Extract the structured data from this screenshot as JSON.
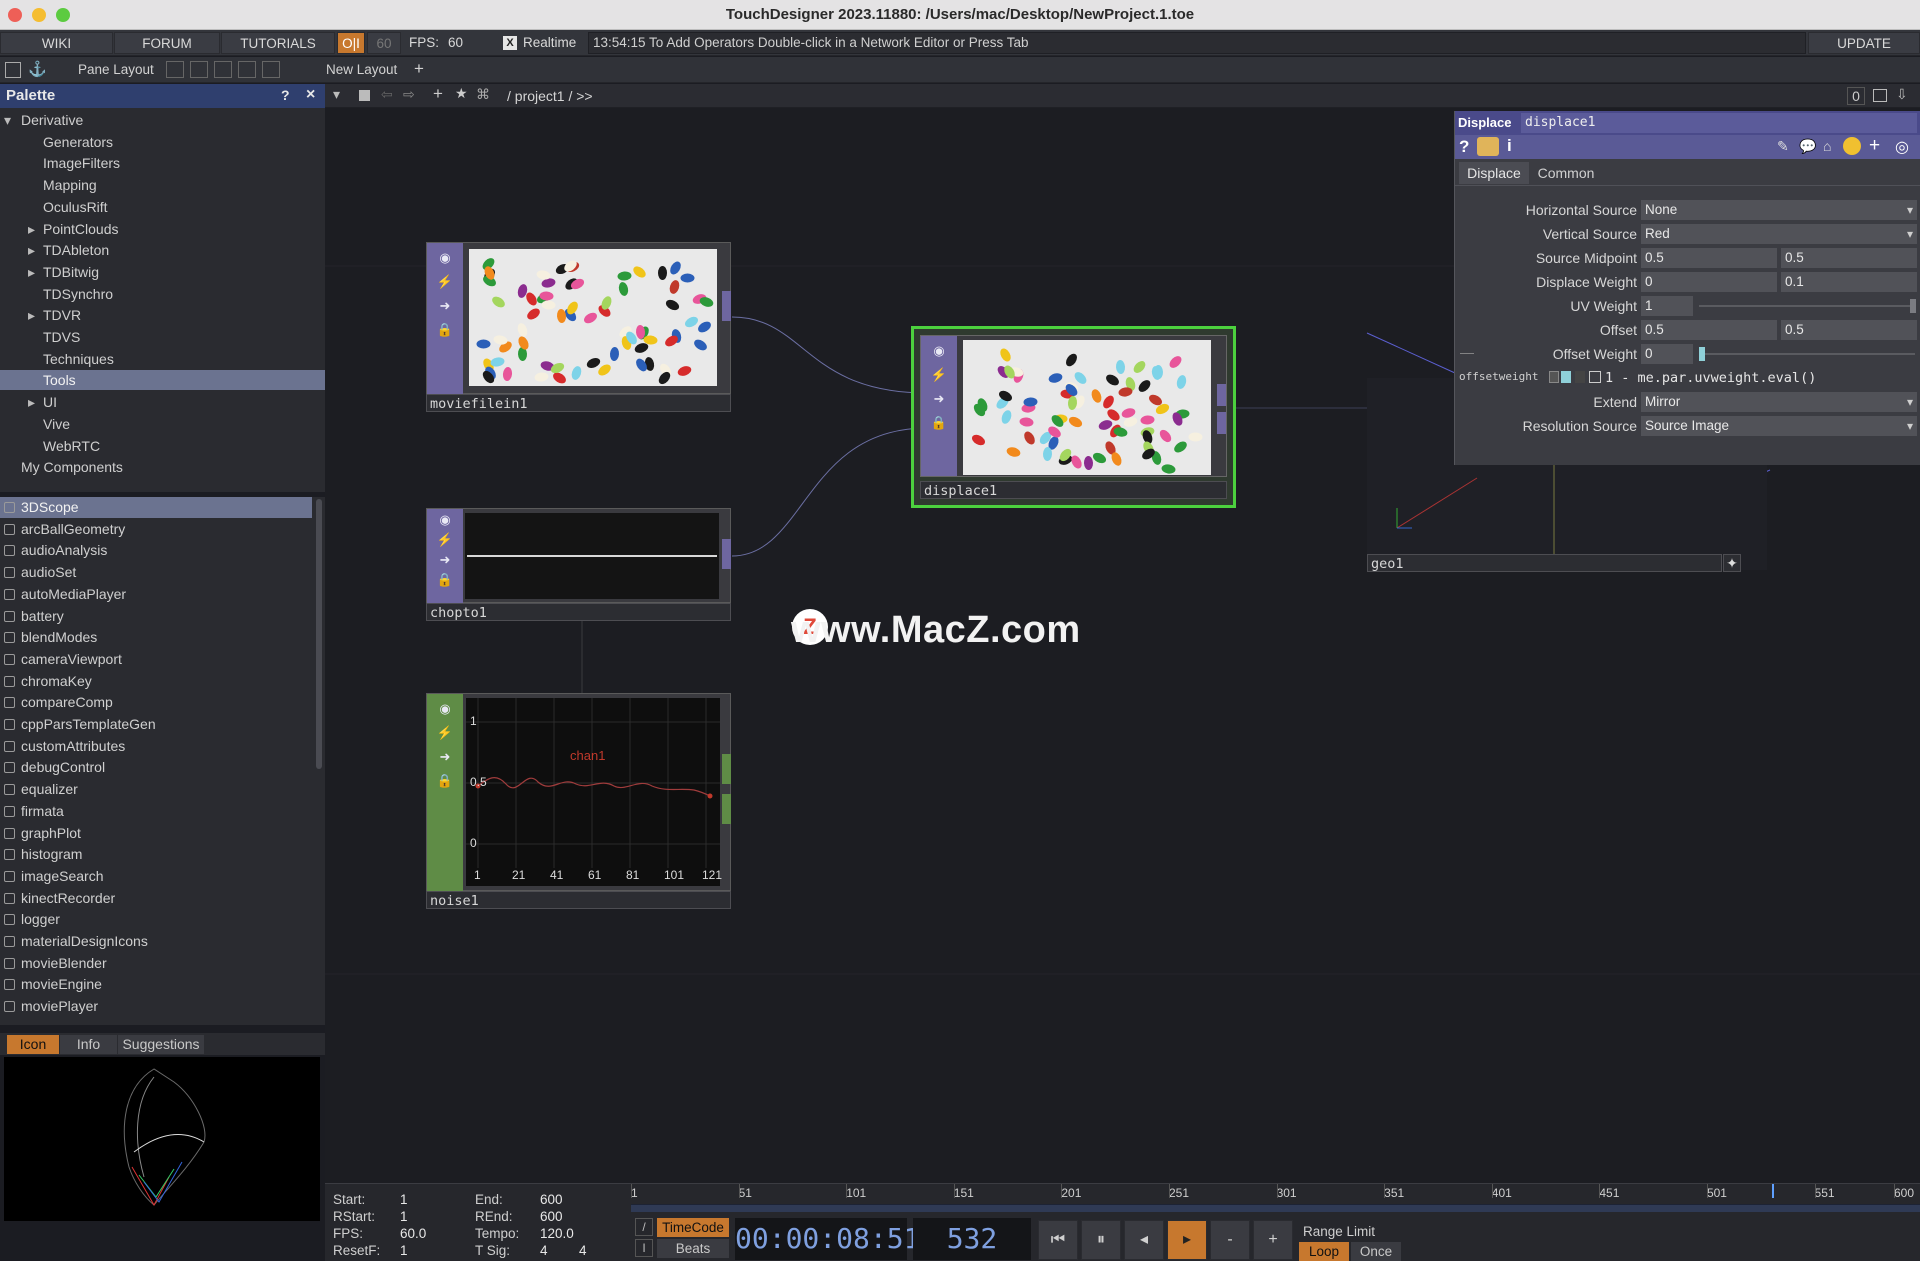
{
  "window": {
    "title": "TouchDesigner 2023.11880: /Users/mac/Desktop/NewProject.1.toe"
  },
  "menubar": {
    "wiki": "WIKI",
    "forum": "FORUM",
    "tutorials": "TUTORIALS",
    "oi": "O|I",
    "fps_setting": "60",
    "fps_label": "FPS:",
    "fps_value": "60",
    "realtime_check": "X",
    "realtime": "Realtime",
    "status": "13:54:15 To Add Operators Double-click in a Network Editor or Press Tab",
    "update": "UPDATE"
  },
  "toolbar": {
    "pane_layout": "Pane Layout",
    "new_layout": "New Layout",
    "add": "+"
  },
  "palette": {
    "title": "Palette",
    "help": "?",
    "close": "×",
    "tree": [
      {
        "label": "Derivative",
        "indent": 0,
        "arrow": "open"
      },
      {
        "label": "Generators",
        "indent": 2,
        "arrow": ""
      },
      {
        "label": "ImageFilters",
        "indent": 2,
        "arrow": ""
      },
      {
        "label": "Mapping",
        "indent": 2,
        "arrow": ""
      },
      {
        "label": "OculusRift",
        "indent": 2,
        "arrow": ""
      },
      {
        "label": "PointClouds",
        "indent": 1,
        "arrow": "closed"
      },
      {
        "label": "TDAbleton",
        "indent": 1,
        "arrow": "closed"
      },
      {
        "label": "TDBitwig",
        "indent": 1,
        "arrow": "closed"
      },
      {
        "label": "TDSynchro",
        "indent": 2,
        "arrow": ""
      },
      {
        "label": "TDVR",
        "indent": 1,
        "arrow": "closed"
      },
      {
        "label": "TDVS",
        "indent": 2,
        "arrow": ""
      },
      {
        "label": "Techniques",
        "indent": 2,
        "arrow": ""
      },
      {
        "label": "Tools",
        "indent": 2,
        "arrow": "",
        "selected": true
      },
      {
        "label": "UI",
        "indent": 1,
        "arrow": "closed"
      },
      {
        "label": "Vive",
        "indent": 2,
        "arrow": ""
      },
      {
        "label": "WebRTC",
        "indent": 2,
        "arrow": ""
      },
      {
        "label": "My Components",
        "indent": 0.5,
        "arrow": ""
      }
    ],
    "components": [
      "3DScope",
      "arcBallGeometry",
      "audioAnalysis",
      "audioSet",
      "autoMediaPlayer",
      "battery",
      "blendModes",
      "cameraViewport",
      "chromaKey",
      "compareComp",
      "cppParsTemplateGen",
      "customAttributes",
      "debugControl",
      "equalizer",
      "firmata",
      "graphPlot",
      "histogram",
      "imageSearch",
      "kinectRecorder",
      "logger",
      "materialDesignIcons",
      "movieBlender",
      "movieEngine",
      "moviePlayer"
    ],
    "preview_tabs": {
      "icon": "Icon",
      "info": "Info",
      "suggestions": "Suggestions"
    }
  },
  "network": {
    "path": "/ project1 / >>",
    "right_count": "0",
    "nodes": {
      "moviefilein": "moviefilein1",
      "chopto": "chopto1",
      "noise": "noise1",
      "displace": "displace1",
      "geo": "geo1"
    },
    "noise_chart": {
      "series": "chan1",
      "y_labels": [
        "1",
        "0.5",
        "0"
      ],
      "x_labels": [
        "1",
        "21",
        "41",
        "61",
        "81",
        "101",
        "121"
      ]
    },
    "watermark": "www.MacZ.com"
  },
  "params": {
    "op_type": "Displace",
    "op_name": "displace1",
    "tabs": [
      "Displace",
      "Common"
    ],
    "rows": {
      "hsource": {
        "label": "Horizontal Source",
        "value": "None"
      },
      "vsource": {
        "label": "Vertical Source",
        "value": "Red"
      },
      "midpoint": {
        "label": "Source Midpoint",
        "v1": "0.5",
        "v2": "0.5"
      },
      "dweight": {
        "label": "Displace Weight",
        "v1": "0",
        "v2": "0.1"
      },
      "uvweight": {
        "label": "UV Weight",
        "v1": "1"
      },
      "offset": {
        "label": "Offset",
        "v1": "0.5",
        "v2": "0.5"
      },
      "offweight": {
        "label": "Offset Weight",
        "v1": "0"
      },
      "expr": {
        "label": "offsetweight",
        "value": "1 - me.par.uvweight.eval()"
      },
      "extend": {
        "label": "Extend",
        "value": "Mirror"
      },
      "ressource": {
        "label": "Resolution Source",
        "value": "Source Image"
      }
    }
  },
  "timeline": {
    "start_label": "Start:",
    "start": "1",
    "end_label": "End:",
    "end": "600",
    "rstart_label": "RStart:",
    "rstart": "1",
    "rend_label": "REnd:",
    "rend": "600",
    "fps_label": "FPS:",
    "fps": "60.0",
    "tempo_label": "Tempo:",
    "tempo": "120.0",
    "resetf_label": "ResetF:",
    "resetf": "1",
    "tsig_label": "T Sig:",
    "tsig1": "4",
    "tsig2": "4",
    "ticks": [
      "1",
      "51",
      "101",
      "151",
      "201",
      "251",
      "301",
      "351",
      "401",
      "451",
      "501",
      "551",
      "600"
    ],
    "timecode_btn": "TimeCode",
    "beats_btn": "Beats",
    "timecode": "00:00:08:51",
    "frame": "532",
    "minus": "-",
    "plus": "+",
    "range_limit": "Range Limit",
    "loop": "Loop",
    "once": "Once"
  }
}
